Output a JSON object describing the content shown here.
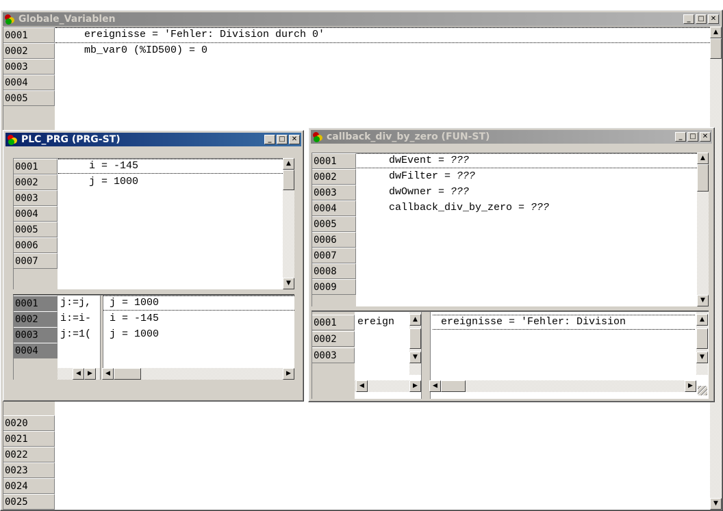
{
  "globals": {
    "title": "Globale_Variablen",
    "lines": [
      "0001",
      "0002",
      "0003",
      "0004",
      "0005"
    ],
    "lines_lower": [
      "0020",
      "0021",
      "0022",
      "0023",
      "0024",
      "0025"
    ],
    "code": [
      "ereignisse = 'Fehler: Division durch 0'",
      "mb_var0 (%ID500) = 0"
    ]
  },
  "plc": {
    "title": "PLC_PRG (PRG-ST)",
    "lines": [
      "0001",
      "0002",
      "0003",
      "0004",
      "0005",
      "0006",
      "0007"
    ],
    "code": [
      "i = -145",
      "j = 1000"
    ],
    "lower_lines": [
      "0001",
      "0002",
      "0003",
      "0004"
    ],
    "lower_left": [
      "j:=j,",
      "i:=i-",
      "j:=1("
    ],
    "lower_right": [
      "j = 1000",
      "i = -145",
      "j = 1000"
    ]
  },
  "callback": {
    "title": "callback_div_by_zero (FUN-ST)",
    "lines": [
      "0001",
      "0002",
      "0003",
      "0004",
      "0005",
      "0006",
      "0007",
      "0008",
      "0009"
    ],
    "code": [
      {
        "name": "dwEvent = ",
        "val": "???"
      },
      {
        "name": "dwFilter = ",
        "val": "???"
      },
      {
        "name": "dwOwner = ",
        "val": "???"
      },
      {
        "name": "callback_div_by_zero = ",
        "val": "???"
      }
    ],
    "lower_lines": [
      "0001",
      "0002",
      "0003"
    ],
    "lower_left": [
      "ereign"
    ],
    "lower_right": [
      "ereignisse = 'Fehler: Division"
    ]
  },
  "icons": {
    "titlebar": "codesys-pou-icon",
    "minimize": "minimize-icon",
    "maximize": "maximize-icon",
    "close": "close-icon"
  },
  "glyphs": {
    "up": "▲",
    "down": "▼",
    "left": "◀",
    "right": "▶",
    "min": "_",
    "max": "□",
    "close": "✕"
  }
}
